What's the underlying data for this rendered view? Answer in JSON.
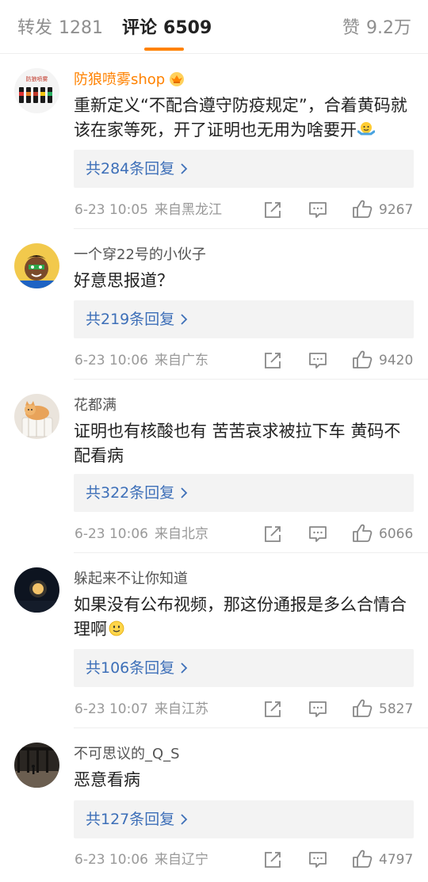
{
  "tabs": {
    "repost": {
      "label": "转发",
      "count": "1281"
    },
    "comments": {
      "label": "评论",
      "count": "6509"
    },
    "likes": {
      "label": "赞",
      "count": "9.2万"
    }
  },
  "colors": {
    "accent": "#ff8200",
    "link": "#3d6fb8",
    "vip_name": "#ff8200"
  },
  "comments": [
    {
      "user": "防狼喷雾shop",
      "badge": "crown-icon",
      "avatar_text": "防狼喷雾",
      "text": "重新定义“不配合遵守防疫规定”，合着黄码就该在家等死，开了证明也无用为啥要开",
      "emoji": "shrug-emoji",
      "replies": "共284条回复",
      "time": "6-23 10:05",
      "location": "来自黑龙江",
      "likes": "9267"
    },
    {
      "user": "一个穿22号的小伙子",
      "text": "好意思报道？",
      "replies": "共219条回复",
      "time": "6-23 10:06",
      "location": "来自广东",
      "likes": "9420"
    },
    {
      "user": "花都满",
      "text": "证明也有核酸也有 苦苦哀求被拉下车 黄码不配看病",
      "replies": "共322条回复",
      "time": "6-23 10:06",
      "location": "来自北京",
      "likes": "6066"
    },
    {
      "user": "躲起来不让你知道",
      "text": "如果没有公布视频，那这份通报是多么合情合理啊",
      "emoji": "smile-emoji",
      "replies": "共106条回复",
      "time": "6-23 10:07",
      "location": "来自江苏",
      "likes": "5827"
    },
    {
      "user": "不可思议的_Q_S",
      "text": "恶意看病",
      "replies": "共127条回复",
      "time": "6-23 10:06",
      "location": "来自辽宁",
      "likes": "4797"
    }
  ]
}
